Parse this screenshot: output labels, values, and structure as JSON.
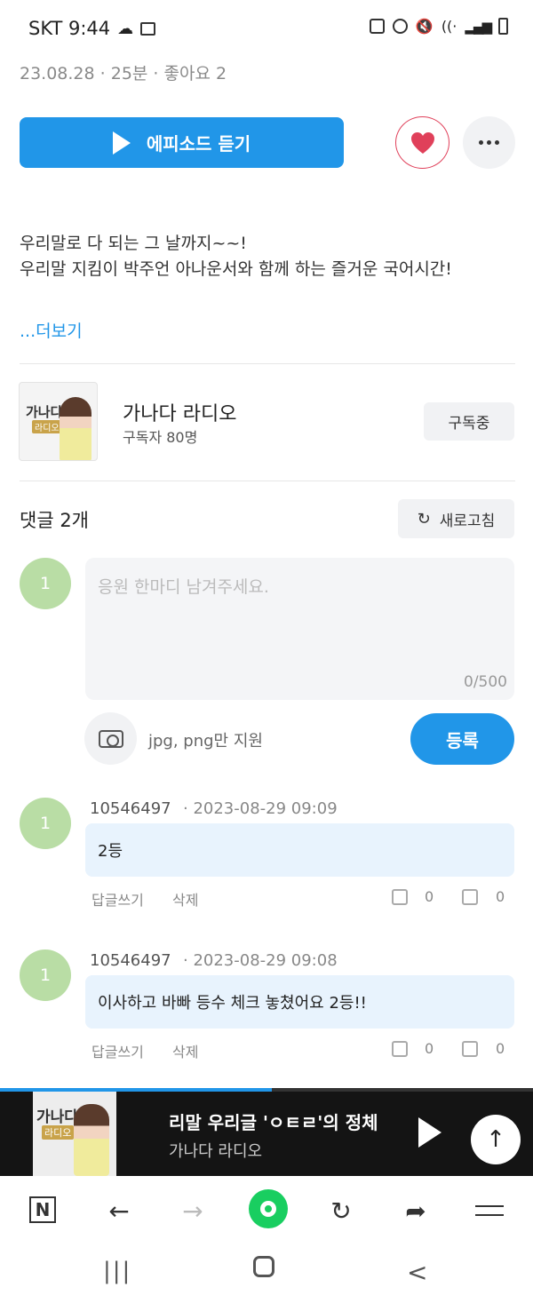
{
  "status_bar": {
    "carrier_time": "SKT 9:44",
    "left_icons": [
      "cloud-icon",
      "image-icon"
    ],
    "right_icons": [
      "recycle-icon",
      "alarm-icon",
      "mute-icon",
      "wifi-icon",
      "signal-icon",
      "battery-icon"
    ]
  },
  "episode": {
    "meta": "23.08.28 · 25분 · 좋아요 2",
    "listen_label": "에피소드 듣기",
    "description": "우리말로 다 되는 그 날까지~~!\n우리말 지킴이 박주언 아나운서와 함께 하는 즐거운 국어시간!",
    "more_label": "...더보기"
  },
  "channel": {
    "thumb_title": "가나다",
    "thumb_sub": "라디오",
    "name": "가나다 라디오",
    "subscribers": "구독자 80명",
    "subscribe_label": "구독중"
  },
  "comments": {
    "title": "댓글 2개",
    "refresh_label": "새로고침",
    "my_avatar": "1",
    "input_placeholder": "응원 한마디 남겨주세요.",
    "char_count": "0/500",
    "image_hint": "jpg, png만 지원",
    "submit_label": "등록",
    "reply_label": "답글쓰기",
    "delete_label": "삭제",
    "items": [
      {
        "avatar": "1",
        "author": "10546497",
        "date": "· 2023-08-29 09:09",
        "text": "2등",
        "likes": "0",
        "dislikes": "0"
      },
      {
        "avatar": "1",
        "author": "10546497",
        "date": "· 2023-08-29 09:08",
        "text": "이사하고 바빠 등수 체크 놓쳤어요 2등!!",
        "likes": "0",
        "dislikes": "0"
      }
    ]
  },
  "mini_player": {
    "title": "리말 우리글 'ㅇㅌㄹ'의 정체",
    "subtitle": "가나다 라디오",
    "progress_fraction": 0.51,
    "thumb_title": "가나다",
    "thumb_sub": "라디오"
  },
  "browser_bar": {
    "n_label": "N",
    "back": "←",
    "forward": "→",
    "reload": "↻",
    "share": "➦"
  },
  "nav_bar": {
    "recent": "|||",
    "home": "○",
    "back": "<"
  },
  "colors": {
    "accent": "#2196e8",
    "heart": "#e0405a",
    "avatar": "#b9dda5",
    "bubble": "#e8f3fd",
    "green": "#19ce60"
  }
}
